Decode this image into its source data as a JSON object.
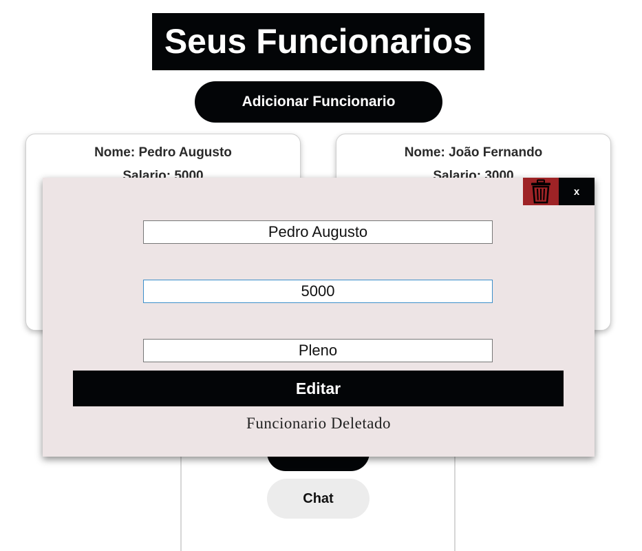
{
  "header": {
    "title": "Seus Funcionarios"
  },
  "actions": {
    "add_label": "Adicionar Funcionario"
  },
  "employees": [
    {
      "name_line": "Nome: Pedro Augusto",
      "salary_line": "Salario: 5000"
    },
    {
      "name_line": "Nome: João Fernando",
      "salary_line": "Salario: 3000"
    }
  ],
  "bottom_panel": {
    "chat_label": "Chat"
  },
  "modal": {
    "close_label": "x",
    "name_value": "Pedro Augusto",
    "salary_value": "5000",
    "level_value": "Pleno",
    "edit_label": "Editar",
    "status_message": "Funcionario Deletado",
    "icons": {
      "delete": "trash-icon"
    }
  },
  "colors": {
    "primary": "#030507",
    "modal_background": "#ede4e5",
    "delete": "#9e2326",
    "focus_border": "#3b8ec9",
    "chat_button": "#ececec"
  }
}
